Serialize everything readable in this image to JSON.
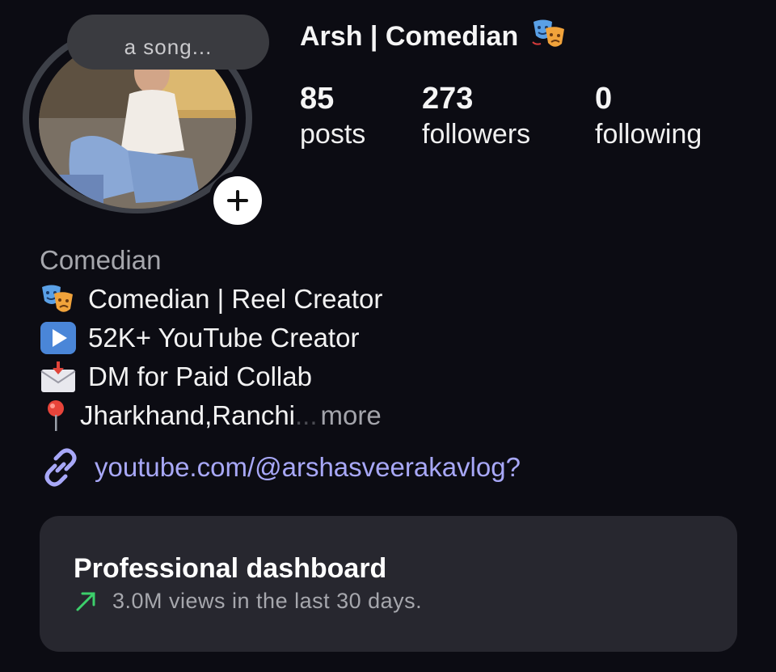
{
  "profile": {
    "note": "a song...",
    "username": "Arsh | Comedian",
    "username_icon": "theater-masks-icon"
  },
  "stats": {
    "posts": {
      "value": "85",
      "label": "posts"
    },
    "followers": {
      "value": "273",
      "label": "followers"
    },
    "following": {
      "value": "0",
      "label": "following"
    }
  },
  "bio": {
    "category": "Comedian",
    "lines": [
      {
        "icon": "theater-masks-icon",
        "text": "Comedian | Reel Creator"
      },
      {
        "icon": "play-button-icon",
        "text": "52K+ YouTube Creator"
      },
      {
        "icon": "envelope-icon",
        "text": "DM for Paid Collab"
      },
      {
        "icon": "pin-icon",
        "text": "Jharkhand,Ranchi"
      }
    ],
    "ellipsis": "...",
    "more_label": "more"
  },
  "link": {
    "icon": "link-icon",
    "text": "youtube.com/@arshasveerakavlog?"
  },
  "dashboard": {
    "title": "Professional dashboard",
    "subtitle": "3.0M views in the last 30 days.",
    "trend_icon": "trend-up-arrow-icon"
  },
  "colors": {
    "background": "#0c0c13",
    "link": "#a8a8f8",
    "trend": "#3ccf6b",
    "card": "#27272f"
  }
}
